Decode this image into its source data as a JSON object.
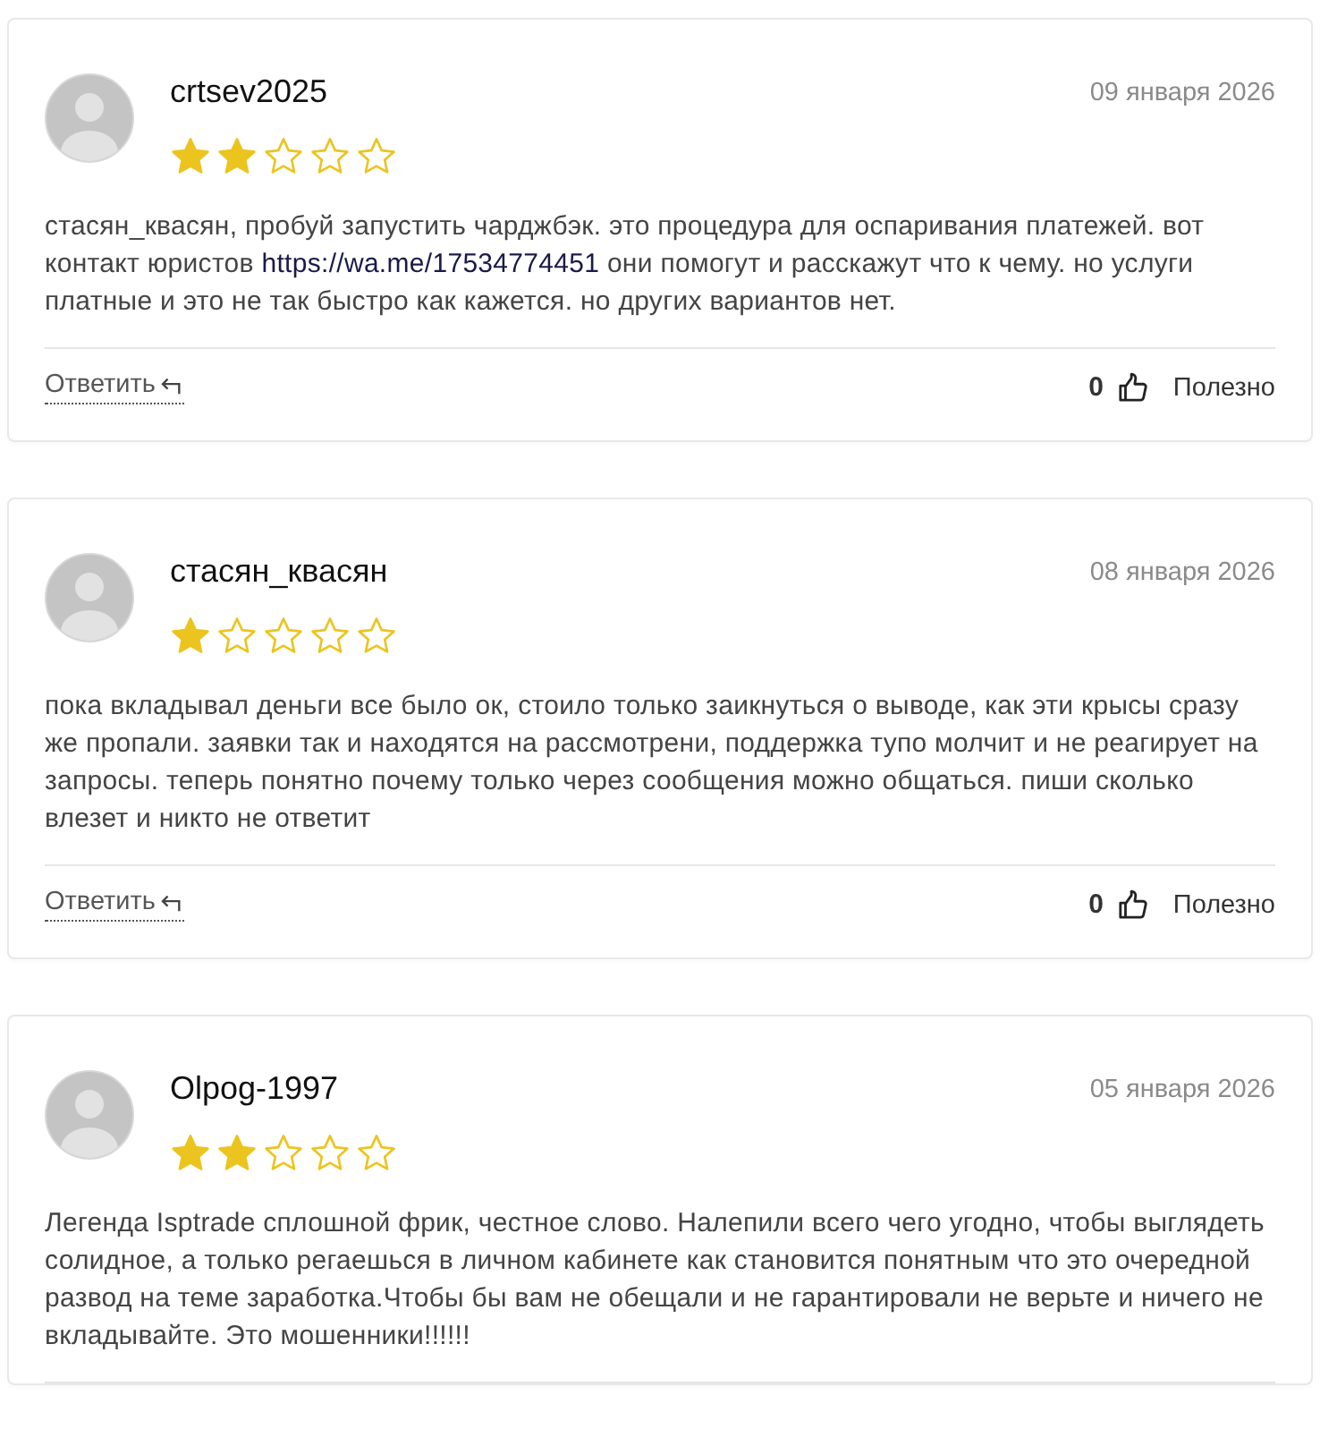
{
  "reviews": [
    {
      "author": "crtsev2025",
      "date": "09 января 2026",
      "stars": 2,
      "body": [
        {
          "kind": "text",
          "text": "стасян_квасян, пробуй запустить чарджбэк. это процедура для оспаривания платежей. вот контакт юристов "
        },
        {
          "kind": "link",
          "text": "https://wa.me/17534774451"
        },
        {
          "kind": "text",
          "text": " они помогут и расскажут что к чему. но услуги платные и это не так быстро как кажется. но других вариантов нет."
        }
      ],
      "footer": {
        "reply": "Ответить",
        "likes": "0",
        "useful": "Полезно"
      }
    },
    {
      "author": "стасян_квасян",
      "date": "08 января 2026",
      "stars": 1,
      "body": [
        {
          "kind": "text",
          "text": "пока вкладывал деньги все было ок, стоило только заикнуться о выводе, как эти крысы сразу же пропали. заявки так и находятся на рассмотрени, поддержка тупо молчит и не реагирует на запросы. теперь понятно почему только через сообщения можно общаться. пиши сколько влезет и никто не ответит"
        }
      ],
      "footer": {
        "reply": "Ответить",
        "likes": "0",
        "useful": "Полезно"
      }
    },
    {
      "author": "Olpog-1997",
      "date": "05 января 2026",
      "stars": 2,
      "body": [
        {
          "kind": "text",
          "text": "Легенда Isptrade сплошной фрик, честное слово. Налепили всего чего угодно, чтобы выглядеть солидное, а только регаешься в личном кабинете как становится понятным что это очередной развод на теме заработка.Чтобы бы вам не обещали и не гарантировали не верьте и ничего не вкладывайте. Это мошенники!!!!!!"
        }
      ]
    }
  ]
}
